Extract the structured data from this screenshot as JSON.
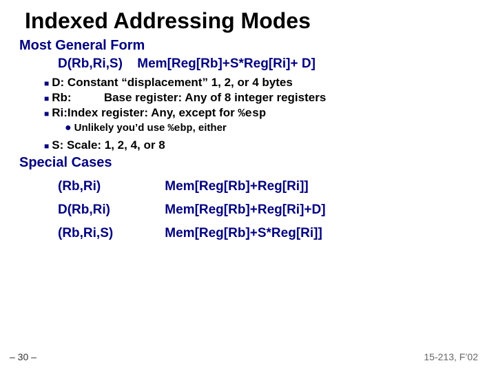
{
  "title": "Indexed Addressing Modes",
  "section1": "Most General Form",
  "formula": {
    "left": "D(Rb,Ri,S)",
    "right": "Mem[Reg[Rb]+S*Reg[Ri]+ D]"
  },
  "bullets": {
    "d": "D: Constant “displacement” 1, 2, or 4 bytes",
    "rb_label": "Rb:",
    "rb_text": "Base register: Any of 8 integer registers",
    "ri_pre": "Ri:Index register: Any, except for ",
    "ri_code": "%esp",
    "sub_pre": "Unlikely you’d use ",
    "sub_code": "%ebp",
    "sub_post": ", either",
    "s": "S: Scale: 1, 2, 4, or 8"
  },
  "section2": "Special Cases",
  "special": [
    {
      "left": "(Rb,Ri)",
      "right": "Mem[Reg[Rb]+Reg[Ri]]"
    },
    {
      "left": "D(Rb,Ri)",
      "right": "Mem[Reg[Rb]+Reg[Ri]+D]"
    },
    {
      "left": "(Rb,Ri,S)",
      "right": "Mem[Reg[Rb]+S*Reg[Ri]]"
    }
  ],
  "footer": {
    "left": "– 30 –",
    "right": "15-213, F’02"
  }
}
